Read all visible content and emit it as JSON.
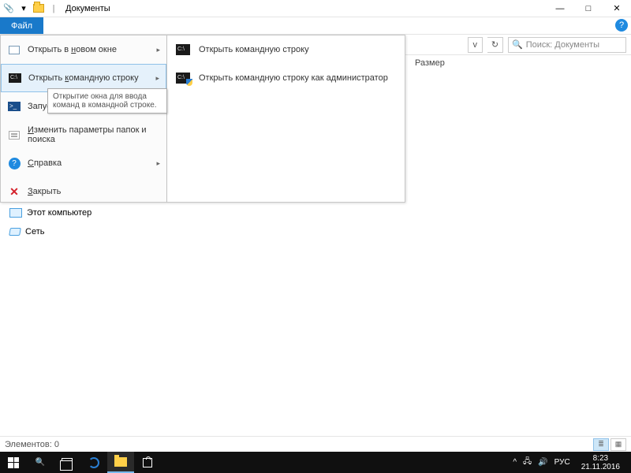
{
  "window": {
    "title": "Документы"
  },
  "ribbon": {
    "file_tab": "Файл"
  },
  "address": {
    "chevron": "v",
    "refresh": "↻",
    "search_placeholder": "Поиск: Документы",
    "search_icon": "🔍"
  },
  "columns": {
    "size": "Размер"
  },
  "file_menu": {
    "items": [
      {
        "label_pre": "Открыть в ",
        "u": "н",
        "label_post": "овом окне",
        "arrow": "▸"
      },
      {
        "label_pre": "Открыть ",
        "u": "к",
        "label_post": "омандную строку",
        "arrow": "▸"
      },
      {
        "label_pre": "Запуст",
        "u": "",
        "label_post": "",
        "arrow": "▸"
      },
      {
        "label_pre": "",
        "u": "И",
        "label_post": "зменить параметры папок и поиска",
        "arrow": ""
      },
      {
        "label_pre": "",
        "u": "С",
        "label_post": "правка",
        "arrow": "▸"
      },
      {
        "label_pre": "",
        "u": "З",
        "label_post": "акрыть",
        "arrow": ""
      }
    ]
  },
  "tooltip": {
    "text": "Открытие окна для ввода команд в командной строке."
  },
  "submenu": {
    "items": [
      {
        "label": "Открыть командную строку"
      },
      {
        "label": "Открыть командную строку как администратор"
      }
    ]
  },
  "nav": {
    "this_pc": "Этот компьютер",
    "network": "Сеть"
  },
  "status": {
    "text": "Элементов: 0"
  },
  "tray": {
    "lang": "РУС",
    "time": "8:23",
    "date": "21.11.2016",
    "chevron": "^",
    "sound": "🔊",
    "net": "🖧"
  }
}
